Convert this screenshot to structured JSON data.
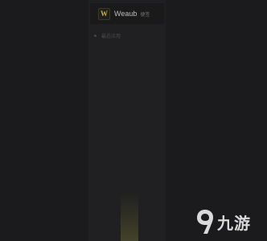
{
  "app": {
    "logo_letter": "W",
    "name": "Weaub",
    "tag": "便签",
    "accent": "#c8b33a"
  },
  "menu": {
    "items": [
      {
        "label": "最近应用",
        "icon": "dot-icon"
      }
    ]
  },
  "watermark": {
    "text": "九游",
    "icon": "ninegame-logo-icon"
  },
  "colors": {
    "background": "#1b1b1d",
    "panel": "#202022",
    "text": "#bdbdbd"
  }
}
